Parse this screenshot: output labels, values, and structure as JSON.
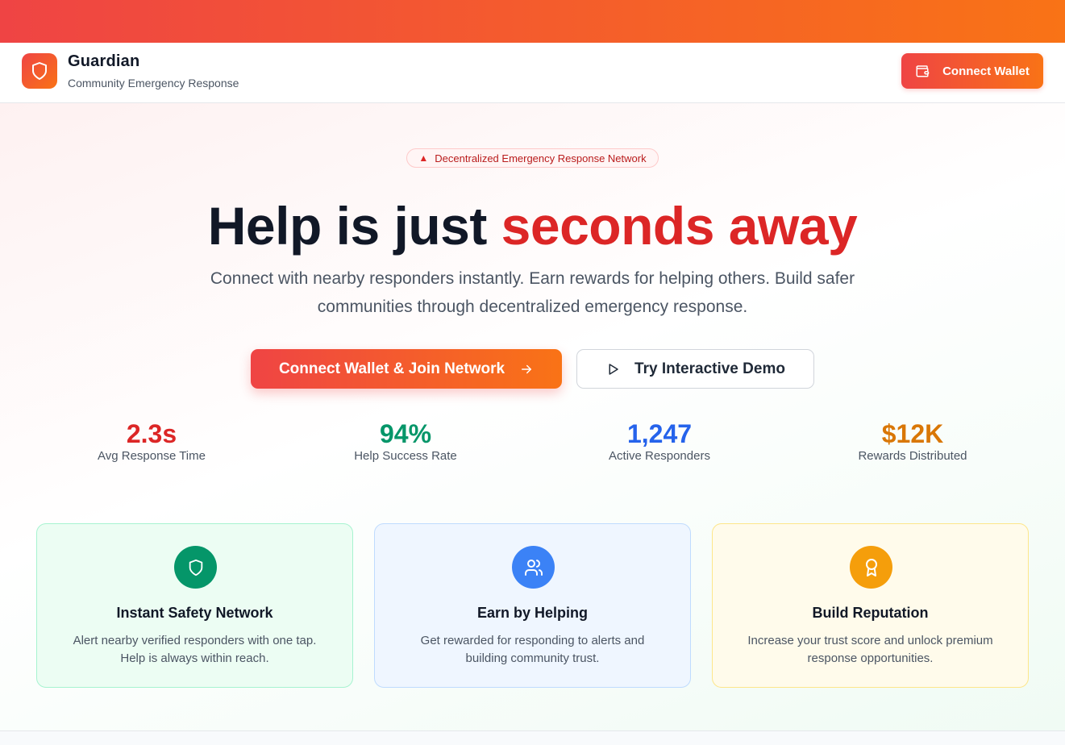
{
  "brand": {
    "name": "Guardian",
    "tagline": "Community Emergency Response",
    "logo_icon": "shield-icon"
  },
  "nav": {
    "connect_wallet_label": "Connect Wallet",
    "wallet_icon": "wallet-icon"
  },
  "hero": {
    "badge_icon": "siren-emoji",
    "badge_text": "Decentralized Emergency Response Network",
    "headline_dark": "Help is just ",
    "headline_accent": "seconds away",
    "subtitle_line1": "Connect with nearby responders instantly. Earn rewards for helping others. Build safer",
    "subtitle_line2": "communities through decentralized emergency response.",
    "primary_cta": "Connect Wallet & Join Network",
    "secondary_cta": "Try Interactive Demo"
  },
  "stats": [
    {
      "value": "2.3s",
      "label": "Avg Response Time",
      "color": "#dc2626"
    },
    {
      "value": "94%",
      "label": "Help Success Rate",
      "color": "#059669"
    },
    {
      "value": "1,247",
      "label": "Active Responders",
      "color": "#2563eb"
    },
    {
      "value": "$12K",
      "label": "Rewards Distributed",
      "color": "#d97706"
    }
  ],
  "features": [
    {
      "icon": "shield-icon",
      "title": "Instant Safety Network",
      "desc_line1": "Alert nearby verified responders with one tap.",
      "desc_line2": "Help is always within reach.",
      "accent": "#059669"
    },
    {
      "icon": "users-icon",
      "title": "Earn by Helping",
      "desc_line1": "Get rewarded for responding to alerts and",
      "desc_line2": "building community trust.",
      "accent": "#3b82f6"
    },
    {
      "icon": "award-icon",
      "title": "Build Reputation",
      "desc_line1": "Increase your trust score and unlock premium",
      "desc_line2": "response opportunities.",
      "accent": "#f59e0b"
    }
  ],
  "colors": {
    "brand_gradient_start": "#ef4444",
    "brand_gradient_end": "#f97316",
    "headline_accent": "#dc2626"
  }
}
